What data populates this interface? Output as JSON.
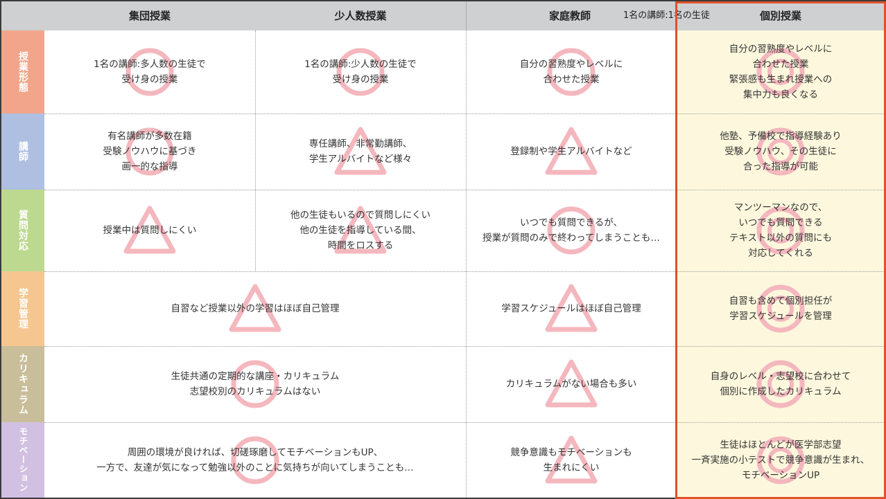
{
  "header": {
    "col1": "集団授業",
    "col2": "少人数授業",
    "col3": "家庭教師",
    "col3_note": "1名の講師:1名の生徒",
    "col4": "個別授業"
  },
  "colors": {
    "header_bg": "#cfd0d2",
    "row1": "#f2a58a",
    "row2": "#aebfe2",
    "row3": "#bcd98f",
    "row4": "#f6c690",
    "row5": "#c9be9a",
    "row6": "#d2c0e2",
    "highlight_bg": "#fdf8dd",
    "highlight_border": "#e0502a",
    "mark": "#f4b7be"
  },
  "rows": [
    {
      "label": "授業形態"
    },
    {
      "label": "講師"
    },
    {
      "label": "質問対応"
    },
    {
      "label": "学習管理"
    },
    {
      "label": "カリキュラム"
    },
    {
      "label": "モチベーション"
    }
  ],
  "cells": {
    "r1c1": {
      "text": "1名の講師:多人数の生徒で\n受け身の授業",
      "mark": "circle"
    },
    "r1c2": {
      "text": "1名の講師:少人数の生徒で\n受け身の授業",
      "mark": "circle"
    },
    "r1c3": {
      "text": "自分の習熟度やレベルに\n合わせた授業",
      "mark": "circle"
    },
    "r1c4": {
      "text": "自分の習熟度やレベルに\n合わせた授業\n緊張感も生まれ授業への\n集中力も良くなる",
      "mark": "double-circle"
    },
    "r2c1": {
      "text": "有名講師が多数在籍\n受験ノウハウに基づき\n画一的な指導",
      "mark": "circle"
    },
    "r2c2": {
      "text": "専任講師、非常勤講師、\n学生アルバイトなど様々",
      "mark": "triangle"
    },
    "r2c3": {
      "text": "登録制や学生アルバイトなど",
      "mark": "triangle"
    },
    "r2c4": {
      "text": "他塾、予備校で指導経験あり\n受験ノウハウ、その生徒に\n合った指導が可能",
      "mark": "double-circle"
    },
    "r3c1": {
      "text": "授業中は質問しにくい",
      "mark": "triangle"
    },
    "r3c2": {
      "text": "他の生徒もいるので質問しにくい\n他の生徒を指導している間、\n時間をロスする",
      "mark": "triangle"
    },
    "r3c3": {
      "text": "いつでも質問できるが、\n授業が質問のみで終わってしまうことも…",
      "mark": "circle"
    },
    "r3c4": {
      "text": "マンツーマンなので、\nいつでも質問できる\nテキスト以外の質問にも\n対応してくれる",
      "mark": "double-circle"
    },
    "r4c12": {
      "text": "自習など授業以外の学習はほぼ自己管理",
      "mark": "triangle"
    },
    "r4c3": {
      "text": "学習スケジュールはほぼ自己管理",
      "mark": "triangle"
    },
    "r4c4": {
      "text": "自習も含めて個別担任が\n学習スケジュールを管理",
      "mark": "double-circle"
    },
    "r5c12": {
      "text": "生徒共通の定期的な講座・カリキュラム\n志望校別のカリキュラムはない",
      "mark": "circle"
    },
    "r5c3": {
      "text": "カリキュラムがない場合も多い",
      "mark": "triangle"
    },
    "r5c4": {
      "text": "自身のレベル・志望校に合わせて\n個別に作成したカリキュラム",
      "mark": "double-circle"
    },
    "r6c12": {
      "text": "周囲の環境が良ければ、切磋琢磨してモチベーションもUP、\n一方で、友達が気になって勉強以外のことに気持ちが向いてしまうことも…",
      "mark": "circle"
    },
    "r6c3": {
      "text": "競争意識もモチベーションも\n生まれにくい",
      "mark": "triangle"
    },
    "r6c4": {
      "text": "生徒はほとんどが医学部志望\n一斉実施の小テストで競争意識が生まれ、\nモチベーションUP",
      "mark": "double-circle"
    }
  }
}
